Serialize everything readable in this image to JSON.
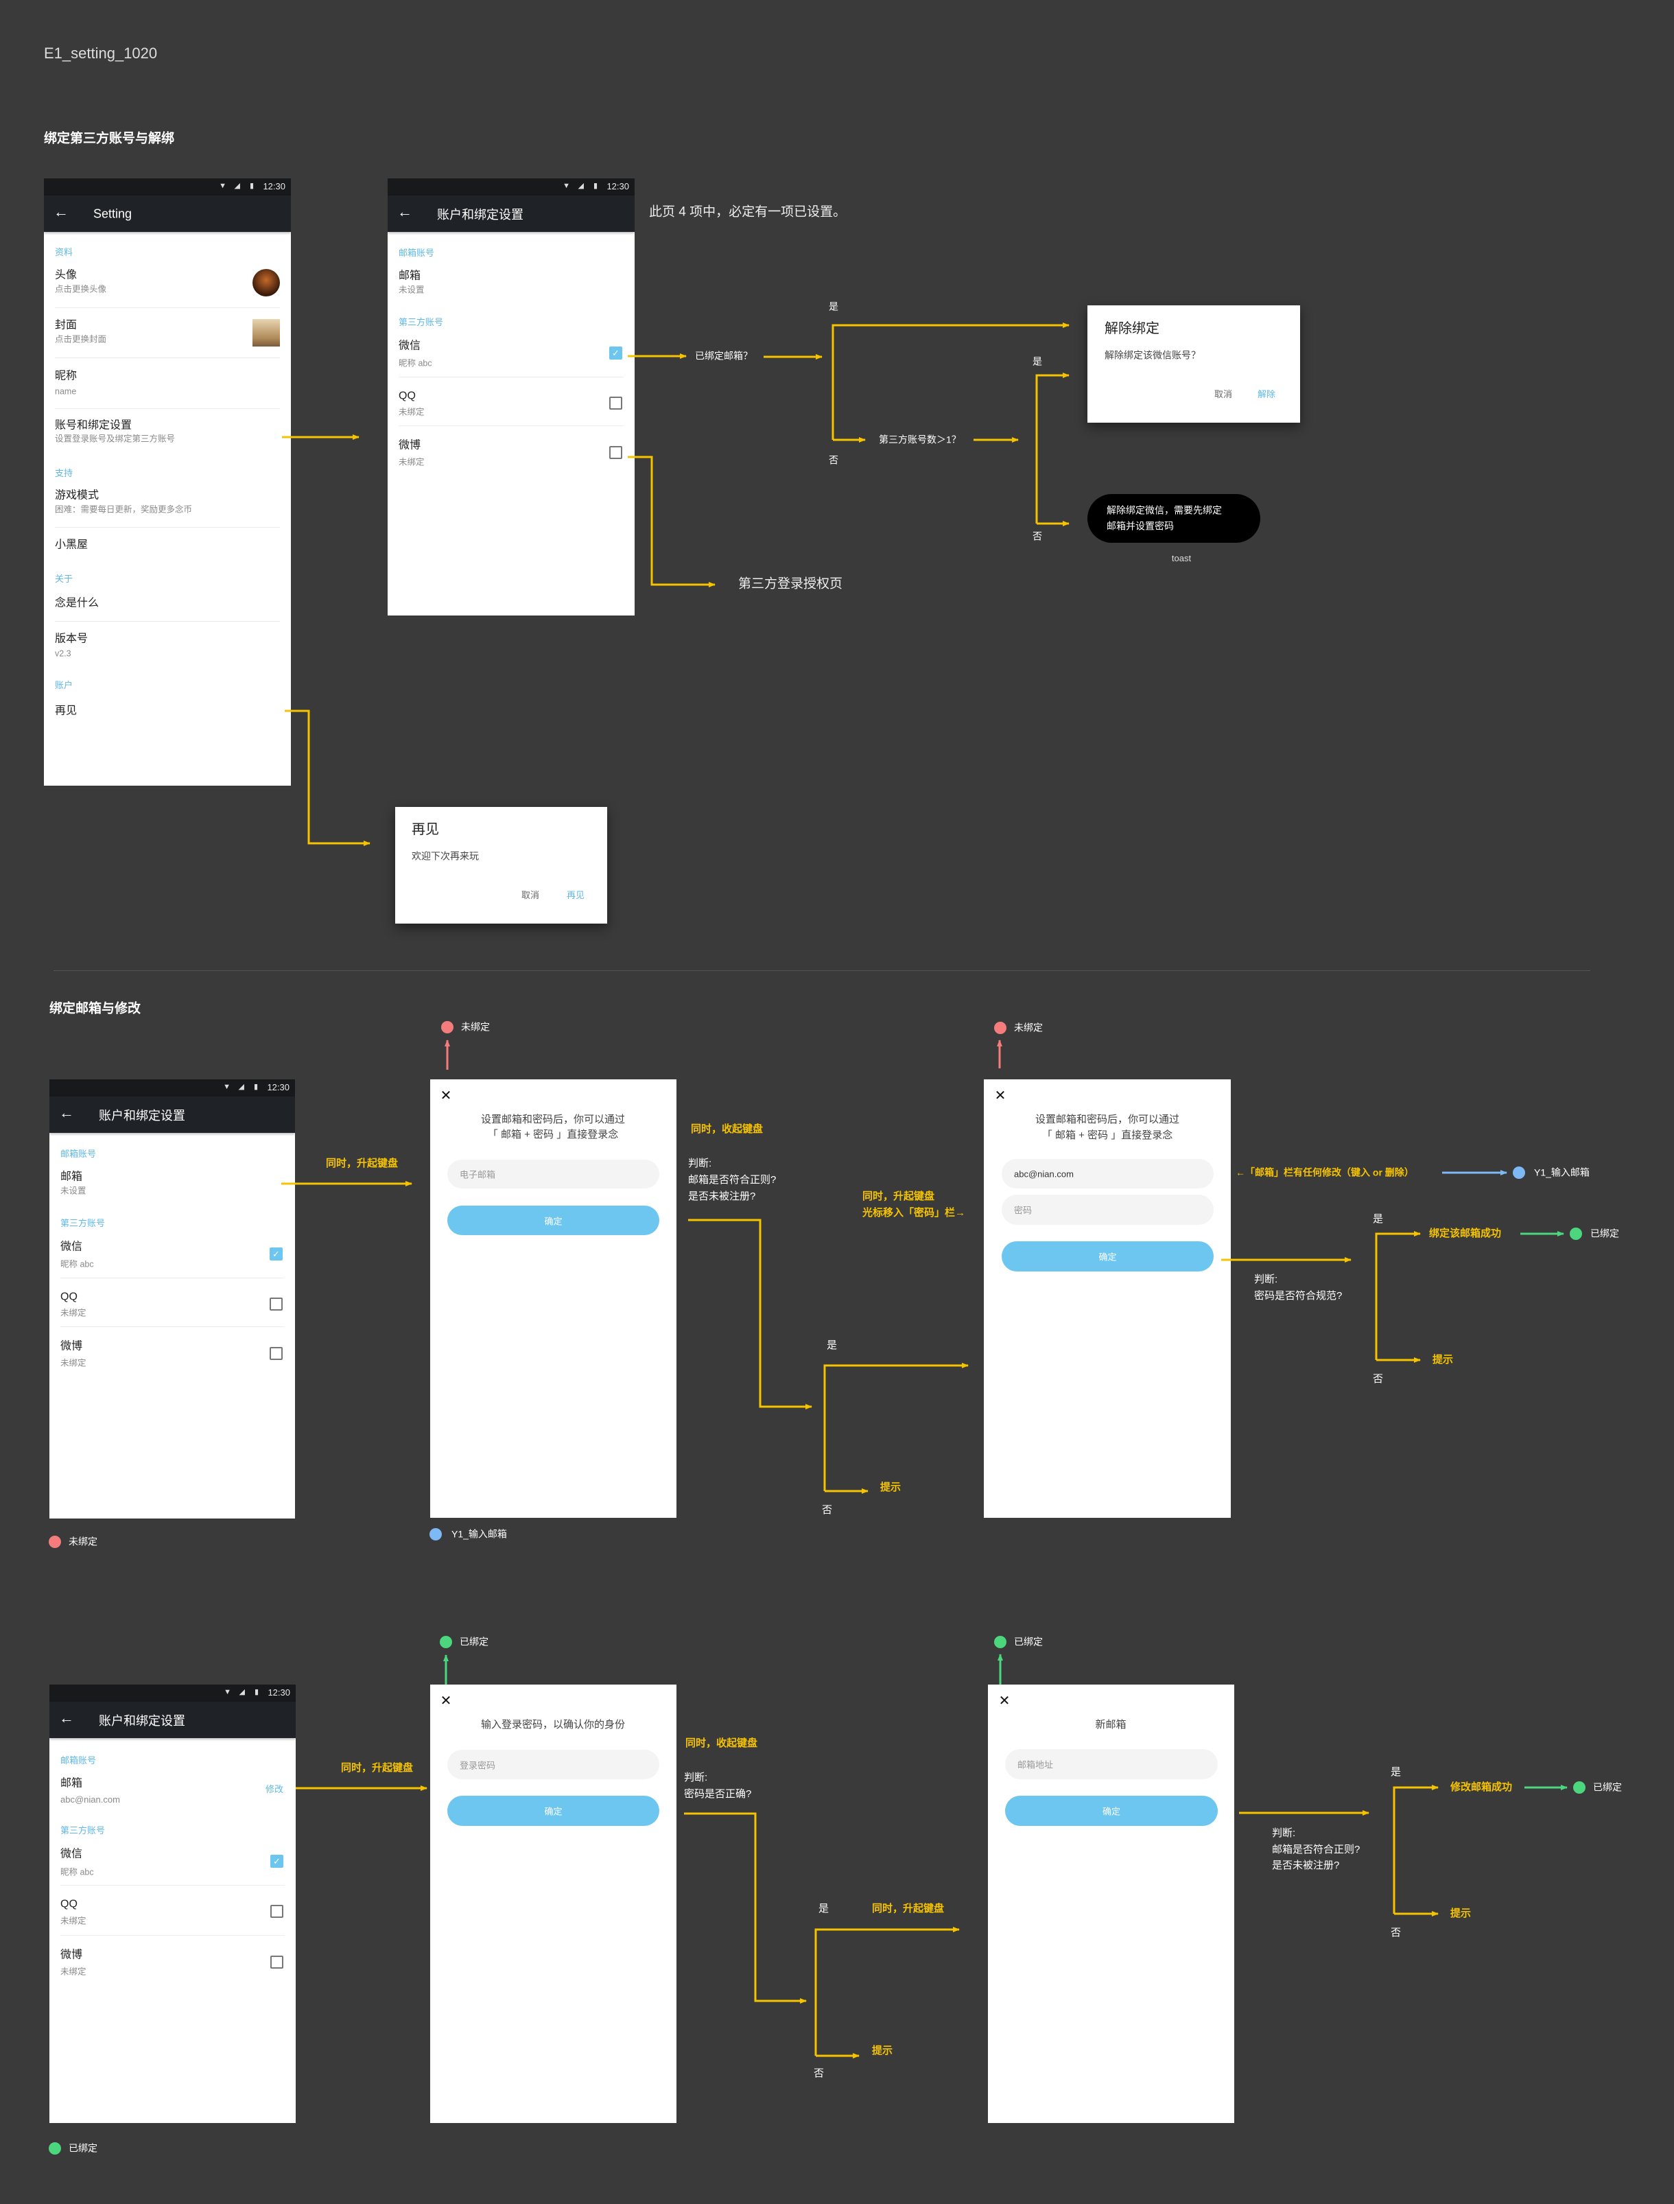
{
  "page_title": "E1_setting_1020",
  "status": {
    "time": "12:30",
    "icons": [
      "wifi-icon",
      "signal-icon",
      "battery-icon"
    ]
  },
  "colors": {
    "background": "#3a3a3a",
    "flow_yellow": "#f6c300",
    "accent_blue": "#6cc6f0",
    "state_unbound": "#f47c7c",
    "state_input": "#7db9f5",
    "state_bound": "#4cd67e"
  },
  "s1": {
    "title": "绑定第三方账号与解绑",
    "settings": {
      "toolbar_title": "Setting",
      "label_profile": "资料",
      "avatar_title": "头像",
      "avatar_sub": "点击更换头像",
      "cover_title": "封面",
      "cover_sub": "点击更换封面",
      "nickname_title": "昵称",
      "nickname_value": "name",
      "account_title": "账号和绑定设置",
      "account_sub": "设置登录账号及绑定第三方账号",
      "label_support": "支持",
      "game_title": "游戏模式",
      "game_sub": "困难：需要每日更新，奖励更多念币",
      "blackroom": "小黑屋",
      "label_about": "关于",
      "about_item": "念是什么",
      "version_title": "版本号",
      "version_value": "v2.3",
      "label_account": "账户",
      "goodbye": "再见"
    },
    "accounts": {
      "toolbar_title": "账户和绑定设置",
      "email_label": "邮箱账号",
      "email_title": "邮箱",
      "email_value": "未设置",
      "third_label": "第三方账号",
      "wechat_title": "微信",
      "wechat_sub": "昵称 abc",
      "wechat_checked": true,
      "qq_title": "QQ",
      "qq_sub": "未绑定",
      "qq_checked": false,
      "weibo_title": "微博",
      "weibo_sub": "未绑定",
      "weibo_checked": false
    },
    "note": "此页 4 项中，必定有一项已设置。",
    "flow": {
      "q_email": "已绑定邮箱？",
      "yes": "是",
      "no": "否",
      "q_count": "第三方账号数＞1？",
      "third_auth": "第三方登录授权页",
      "toast_label": "toast"
    },
    "unbind_dialog": {
      "title": "解除绑定",
      "body": "解除绑定该微信账号？",
      "cancel": "取消",
      "confirm": "解除"
    },
    "toast": {
      "line1": "解除绑定微信，需要先绑定",
      "line2": "邮箱并设置密码"
    },
    "goodbye_dialog": {
      "title": "再见",
      "body": "欢迎下次再来玩",
      "cancel": "取消",
      "confirm": "再见"
    }
  },
  "s2": {
    "title": "绑定邮箱与修改",
    "state_unbound": "未绑定",
    "state_input": "Y1_输入邮箱",
    "state_bound": "已绑定",
    "raise_keyboard": "同时，升起键盘",
    "hide_keyboard": "同时，收起键盘",
    "judge": "判断:",
    "q_regex": "邮箱是否符合正则?",
    "q_registered": "是否未被注册?",
    "raise_keyboard2": "同时，升起键盘",
    "cursor_move": "光标移入「密码」栏→",
    "yes": "是",
    "no": "否",
    "hint": "提示",
    "email_modified": "←「邮箱」栏有任何修改（键入 or 删除）",
    "q_password": "密码是否符合规范?",
    "bind_success": "绑定该邮箱成功",
    "modal1": {
      "line1": "设置邮箱和密码后，你可以通过",
      "line2": "「 邮箱 + 密码 」直接登录念",
      "email_placeholder": "电子邮箱",
      "confirm": "确定"
    },
    "modal2": {
      "line1": "设置邮箱和密码后，你可以通过",
      "line2": "「 邮箱 + 密码 」直接登录念",
      "email_value": "abc@nian.com",
      "password_placeholder": "密码",
      "confirm": "确定"
    }
  },
  "s3": {
    "accounts": {
      "email_value": "abc@nian.com",
      "edit_label": "修改"
    },
    "state_bound": "已绑定",
    "raise_keyboard": "同时，升起键盘",
    "hide_keyboard": "同时，收起键盘",
    "judge": "判断:",
    "q_password_correct": "密码是否正确?",
    "raise_keyboard2": "同时，升起键盘",
    "yes": "是",
    "no": "否",
    "hint": "提示",
    "q_regex": "邮箱是否符合正则?",
    "q_registered": "是否未被注册?",
    "modify_success": "修改邮箱成功",
    "modal1": {
      "title": "输入登录密码，以确认你的身份",
      "password_placeholder": "登录密码",
      "confirm": "确定"
    },
    "modal2": {
      "title": "新邮箱",
      "email_placeholder": "邮箱地址",
      "confirm": "确定"
    }
  }
}
